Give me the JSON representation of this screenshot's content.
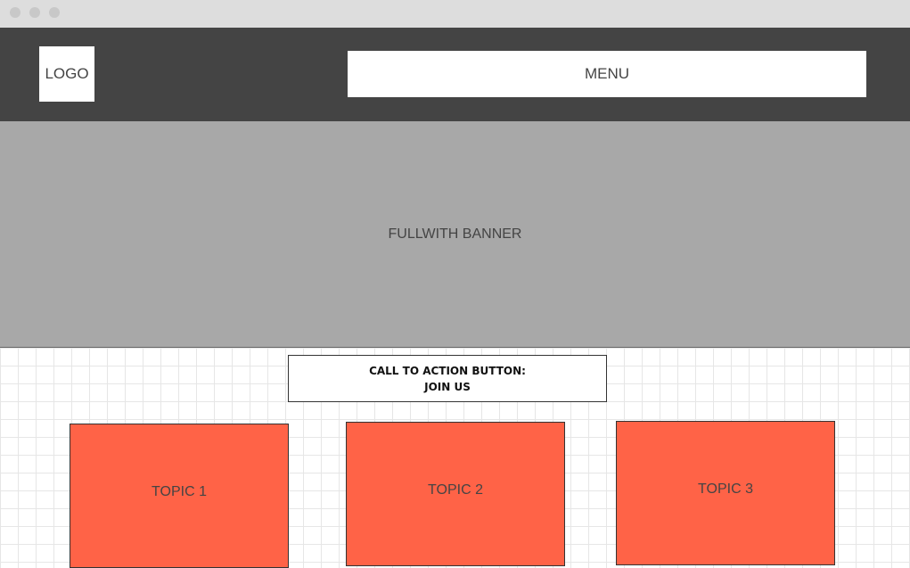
{
  "window": {
    "controls": [
      "close-dot",
      "minimize-dot",
      "maximize-dot"
    ]
  },
  "header": {
    "logo_label": "LOGO",
    "menu_label": "MENU"
  },
  "banner": {
    "label": "FULLWITH BANNER"
  },
  "cta": {
    "line1": "CALL TO ACTION BUTTON:",
    "line2": "JOIN US"
  },
  "topics": [
    {
      "label": "TOPIC 1"
    },
    {
      "label": "TOPIC 2"
    },
    {
      "label": "TOPIC 3"
    }
  ],
  "colors": {
    "header_bg": "#444444",
    "banner_bg": "#a8a8a8",
    "topic_bg": "#ff6347",
    "titlebar_bg": "#dddddd"
  }
}
